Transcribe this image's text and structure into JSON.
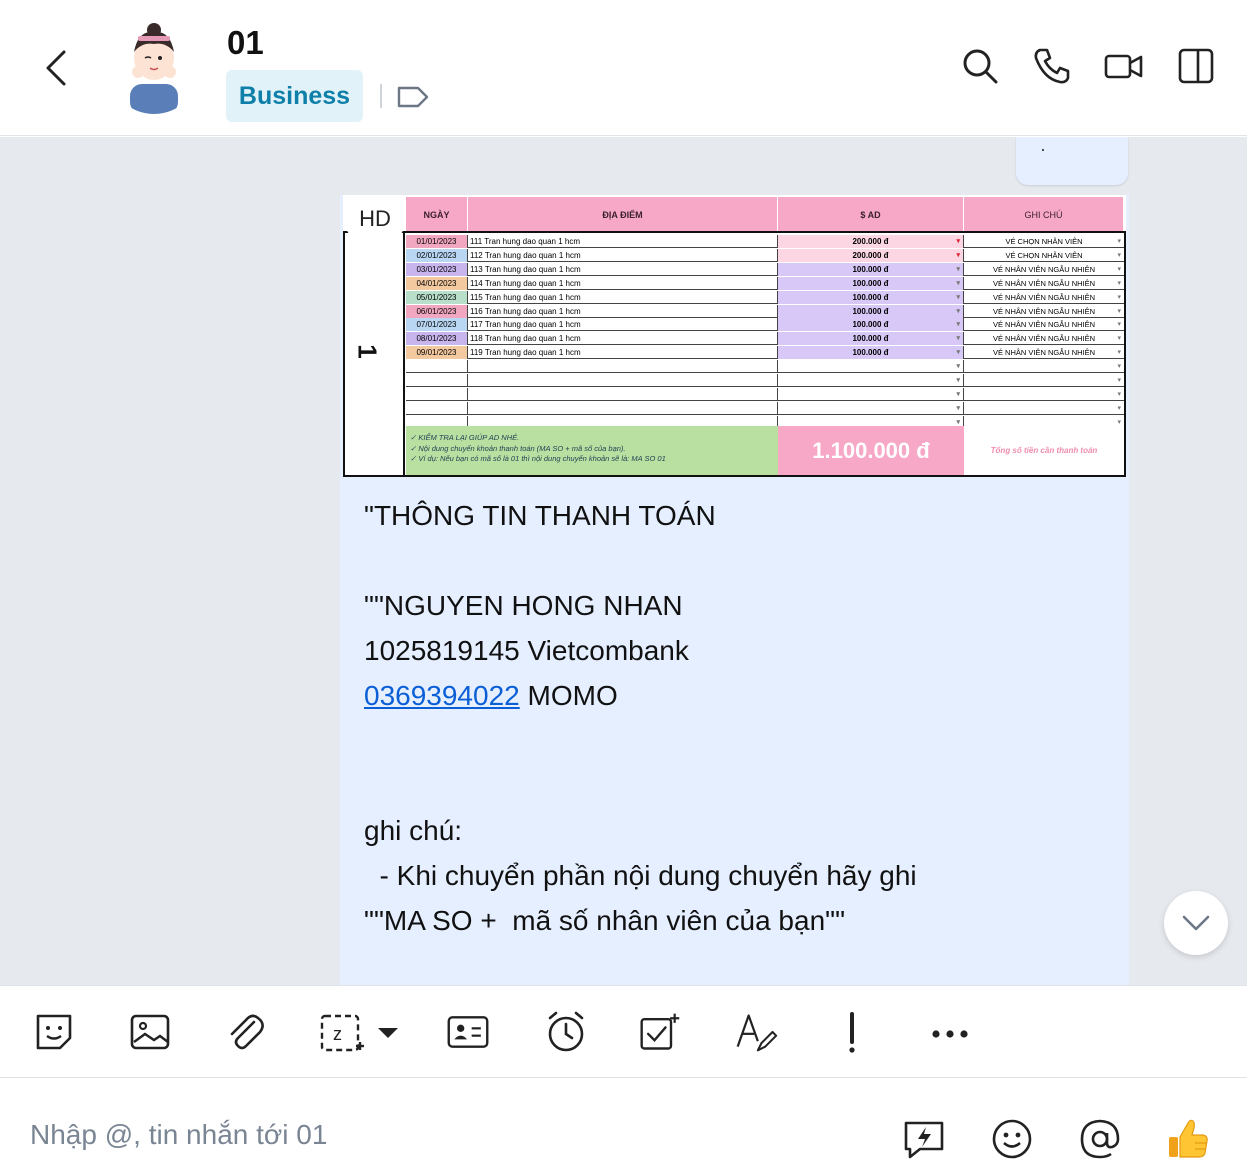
{
  "header": {
    "title": "01",
    "badge": "Business"
  },
  "sheet": {
    "hd_label": "HD",
    "columns": [
      "NGÀY",
      "ĐỊA ĐIỂM",
      "$ AD",
      "GHI CHÚ"
    ],
    "group_number": "1",
    "rows": [
      {
        "date": "01/01/2023",
        "location": "111 Tran hung dao quan 1 hcm",
        "amount": "200.000 đ",
        "note": "VÉ CHỌN NHÂN VIÊN",
        "date_color": "#f2a7c0",
        "amt_color": "#fcd6e2"
      },
      {
        "date": "02/01/2023",
        "location": "112 Tran hung dao quan 1 hcm",
        "amount": "200.000 đ",
        "note": "VÉ CHỌN NHÂN VIÊN",
        "date_color": "#b9d6f2",
        "amt_color": "#fcd6e2"
      },
      {
        "date": "03/01/2023",
        "location": "113 Tran hung dao quan 1 hcm",
        "amount": "100.000 đ",
        "note": "VÉ NHÂN VIÊN NGẪU NHIÊN",
        "date_color": "#c9b5ee",
        "amt_color": "#d7c8f7"
      },
      {
        "date": "04/01/2023",
        "location": "114 Tran hung dao quan 1 hcm",
        "amount": "100.000 đ",
        "note": "VÉ NHÂN VIÊN NGẪU NHIÊN",
        "date_color": "#f3c9a0",
        "amt_color": "#d7c8f7"
      },
      {
        "date": "05/01/2023",
        "location": "115 Tran hung dao quan 1 hcm",
        "amount": "100.000 đ",
        "note": "VÉ NHÂN VIÊN NGẪU NHIÊN",
        "date_color": "#b7dfc9",
        "amt_color": "#d7c8f7"
      },
      {
        "date": "06/01/2023",
        "location": "116 Tran hung dao quan 1 hcm",
        "amount": "100.000 đ",
        "note": "VÉ NHÂN VIÊN NGẪU NHIÊN",
        "date_color": "#f2a7c0",
        "amt_color": "#d7c8f7"
      },
      {
        "date": "07/01/2023",
        "location": "117 Tran hung dao quan 1 hcm",
        "amount": "100.000 đ",
        "note": "VÉ NHÂN VIÊN NGẪU NHIÊN",
        "date_color": "#b9d6f2",
        "amt_color": "#d7c8f7"
      },
      {
        "date": "08/01/2023",
        "location": "118 Tran hung dao quan 1 hcm",
        "amount": "100.000 đ",
        "note": "VÉ NHÂN VIÊN NGẪU NHIÊN",
        "date_color": "#c9b5ee",
        "amt_color": "#d7c8f7"
      },
      {
        "date": "09/01/2023",
        "location": "119 Tran hung dao quan 1 hcm",
        "amount": "100.000 đ",
        "note": "VÉ NHÂN VIÊN NGẪU NHIÊN",
        "date_color": "#f3c9a0",
        "amt_color": "#d7c8f7"
      }
    ],
    "footer_lines": [
      "✓ KIỂM TRA LẠI GIÚP AD NHÉ.",
      "✓ Nội dung chuyển khoản thanh toán  (MA SO + mã số của bạn).",
      "✓ Ví dụ: Nếu bạn có mã số là 01 thì nội dung chuyển khoản sẽ là:  MA SO 01"
    ],
    "total": "1.100.000 đ",
    "total_note": "Tổng số tiền cần thanh toán"
  },
  "message": {
    "lines": [
      "\"THÔNG TIN THANH TOÁN",
      "",
      "\"\"NGUYEN HONG NHAN",
      "1025819145 Vietcombank"
    ],
    "phone": "0369394022",
    "phone_suffix": " MOMO",
    "lines_after": [
      "",
      "",
      "ghi chú:",
      "  - Khi chuyển phần nội dung chuyển hãy ghi",
      "\"\"MA SO +  mã số nhân viên của bạn\"\""
    ]
  },
  "input": {
    "placeholder": "Nhập @, tin nhắn tới 01"
  },
  "colors": {
    "accent": "#0e7fa8",
    "chat_bg": "#e6e9ee",
    "bubble": "#e5efff",
    "header_pink": "#f7a8c6",
    "link": "#0b5fd6"
  }
}
